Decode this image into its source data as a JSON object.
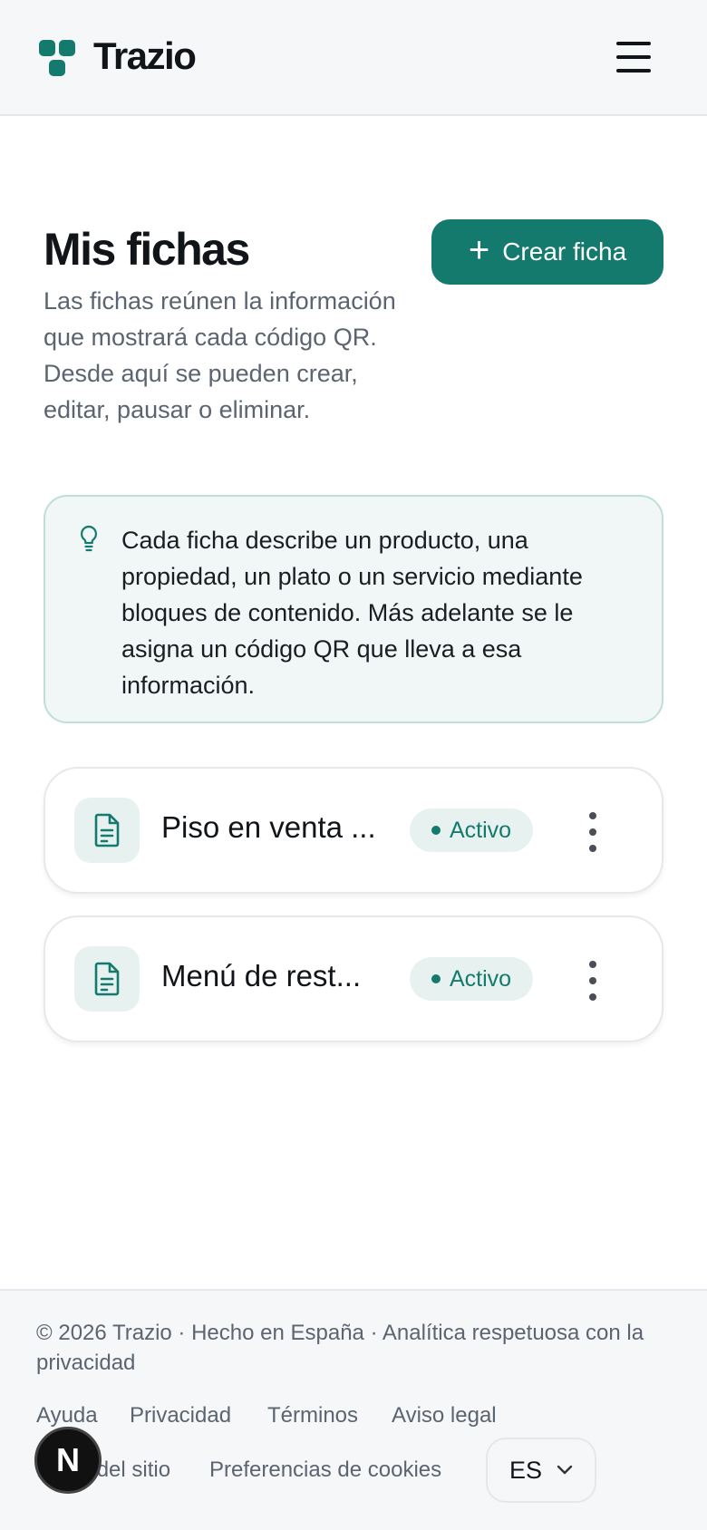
{
  "header": {
    "brand": "Trazio",
    "brand_color": "#157a6e"
  },
  "page": {
    "title": "Mis fichas",
    "description": "Las fichas reúnen la información que mostrará cada código QR. Desde aquí se pueden crear, editar, pausar o eliminar.",
    "create_button": {
      "icon": "plus-icon",
      "label": "Crear ficha"
    }
  },
  "tip": {
    "icon": "lightbulb-icon",
    "text": "Cada ficha describe un producto, una propiedad, un plato o un servicio mediante bloques de contenido. Más adelante se le asigna un código QR que lleva a esa información."
  },
  "cards": [
    {
      "icon": "file-text-icon",
      "title": "Piso en venta ...",
      "status": "Activo"
    },
    {
      "icon": "file-text-icon",
      "title": "Menú de rest...",
      "status": "Activo"
    }
  ],
  "footer": {
    "copyright": "© 2026 Trazio · Hecho en España · Analítica respetuosa con la privacidad",
    "links": [
      "Ayuda",
      "Privacidad",
      "Términos",
      "Aviso legal",
      "Mapa del sitio",
      "Preferencias de cookies"
    ],
    "language": "ES"
  },
  "dev_badge": "N"
}
